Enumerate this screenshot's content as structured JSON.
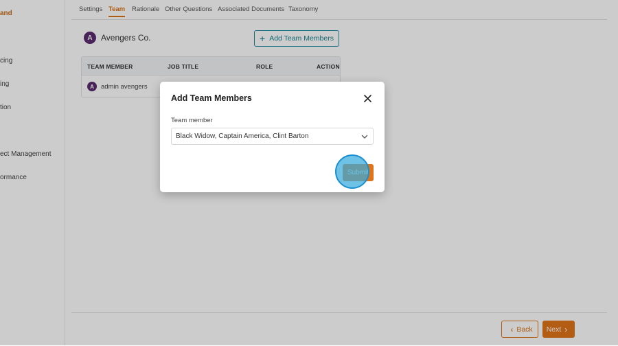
{
  "sidebar": {
    "items": [
      {
        "label": "and",
        "active": true
      },
      {
        "label": "cing"
      },
      {
        "label": "ing"
      },
      {
        "label": "tion"
      },
      {
        "label": "ect Management"
      },
      {
        "label": "ormance"
      }
    ]
  },
  "tabs": [
    "Settings",
    "Team",
    "Rationale",
    "Other Questions",
    "Associated Documents",
    "Taxonomy"
  ],
  "team": {
    "org_name": "Avengers Co.",
    "add_button_label": "Add Team Members",
    "columns": [
      "TEAM MEMBER",
      "JOB TITLE",
      "ROLE",
      "ACTION"
    ],
    "rows": [
      {
        "member": "admin avengers",
        "job_title": "",
        "role": "",
        "action": ""
      }
    ]
  },
  "footer": {
    "back_label": "Back",
    "next_label": "Next"
  },
  "modal": {
    "title": "Add Team Members",
    "field_label": "Team member",
    "selected_value": "Black Widow, Captain America, Clint Barton",
    "submit_label": "Submit"
  },
  "colors": {
    "accent": "#e0741a",
    "teal": "#1a8a9a",
    "click_indicator": "#34aadc"
  },
  "icons": {
    "close": "close-icon",
    "chevron": "chevron-down-icon",
    "plus": "plus-icon",
    "avatar": "avengers-logo-icon"
  }
}
